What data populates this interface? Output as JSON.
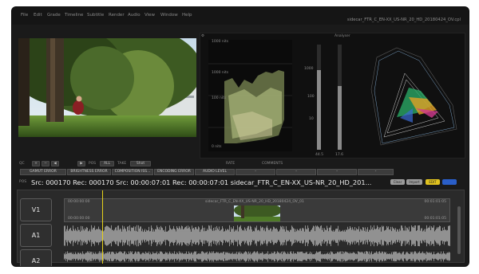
{
  "menu": [
    "File",
    "Edit",
    "Grade",
    "Timeline",
    "Subtitle",
    "Render",
    "Audio",
    "View",
    "Window",
    "Help"
  ],
  "file_title": "sidecar_FTR_C_EN-XX_US-NR_20_HD_20180424_OV.cpl",
  "scopes": {
    "waveform_labels": [
      "1000 nits",
      "1000 nits",
      "100 nits",
      "0 nits"
    ],
    "vector_scale": [
      "1000",
      "100",
      "10"
    ],
    "analyser_title": "Analyser",
    "meter_values": [
      "44.5",
      "17.6"
    ]
  },
  "qc": {
    "label": "QC",
    "pos_label": "POS",
    "pos_value": "ALL",
    "take_label": "TAKE",
    "take_value": "Shot",
    "rate_label": "RATE",
    "comments_label": "COMMENTS",
    "error_buttons": [
      "GAMUT ERROR",
      "BRIGHTNESS ERROR",
      "COMPOSITION ISS...",
      "ENCODING ERROR",
      "AUDIO LEVEL",
      "-",
      "-",
      "-",
      "-"
    ]
  },
  "timecode": {
    "pos_tag": "POS",
    "line": "Src: 000170   Rec: 000170 Src: 00:00:07:01   Rec: 00:00:07:01  sidecar_FTR_C_EN-XX_US-NR_20_HD_201..."
  },
  "badges": [
    {
      "label": "Clear",
      "color": "#9b9b9b"
    },
    {
      "label": "Import",
      "color": "#9b9b9b"
    },
    {
      "label": "EDIT",
      "color": "#e0c21f"
    },
    {
      "label": "",
      "color": "#2a5ec8"
    }
  ],
  "timeline": {
    "tracks": [
      "V1",
      "A1",
      "A2"
    ],
    "clip_name": "sidecar_FTR_C_EN-XX_US-NR_20_HD_20180424_OV_01",
    "tc_start": "00:00:00:00",
    "tc_end": "00:01:01:05",
    "tc_bottom_start": "00:00:00:00",
    "tc_bottom_end": "00:01:01:05"
  }
}
